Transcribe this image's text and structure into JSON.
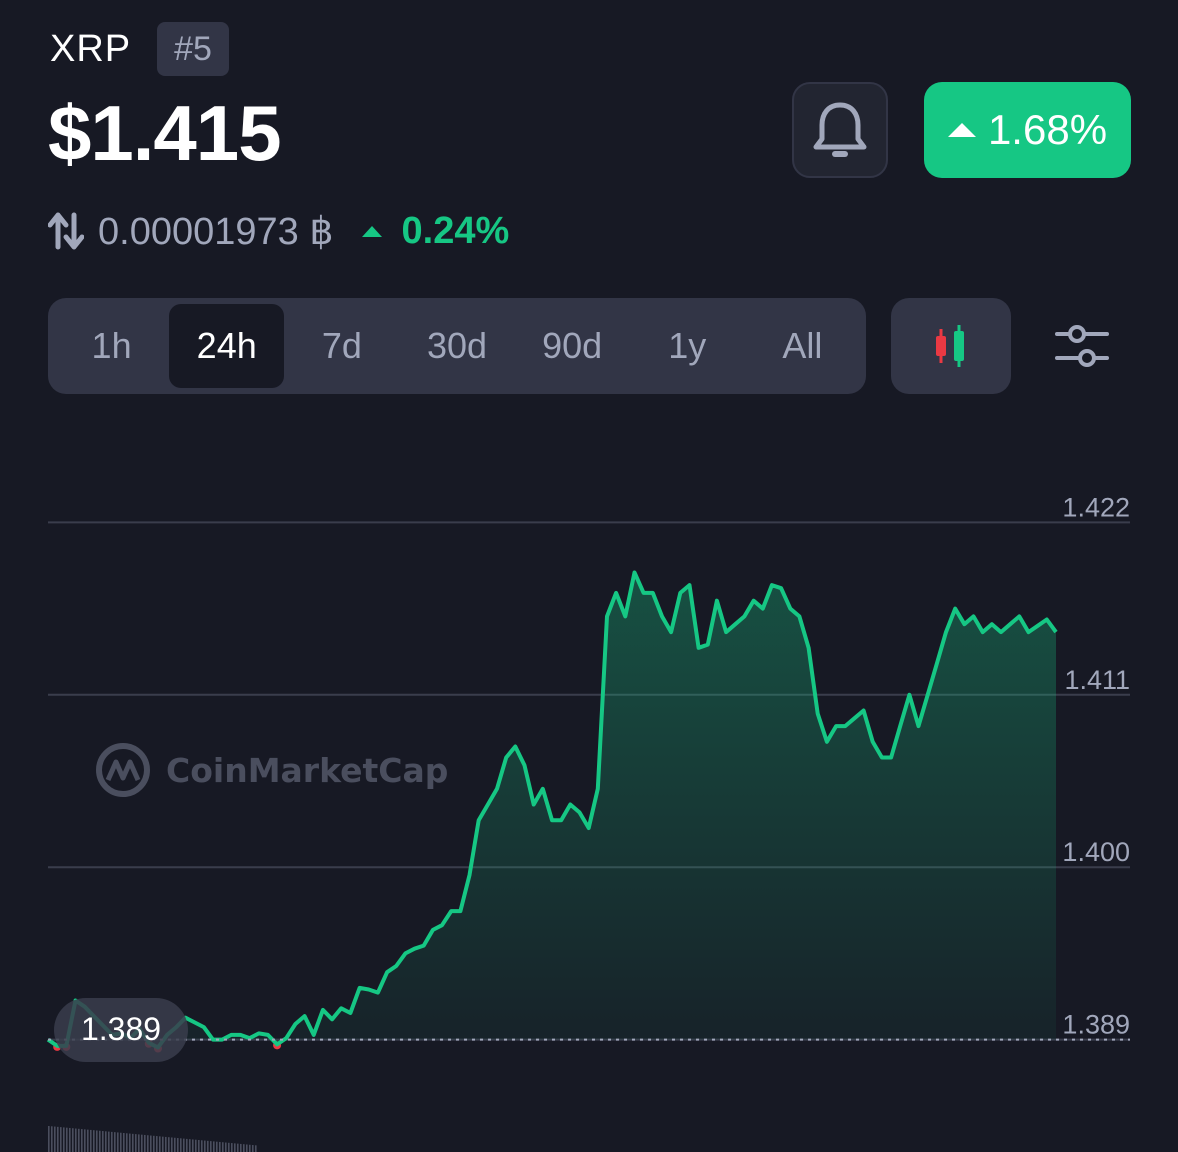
{
  "coin": {
    "symbol": "XRP",
    "rank": "#5",
    "price": "$1.415",
    "change_24h": "1.68%",
    "btc_price": "0.00001973 ฿",
    "btc_change": "0.24%"
  },
  "range_tabs": [
    "1h",
    "24h",
    "7d",
    "30d",
    "90d",
    "1y",
    "All"
  ],
  "active_range": "24h",
  "colors": {
    "background": "#171924",
    "up": "#16c784",
    "down": "#ea3943",
    "panel": "#323546"
  },
  "icons": [
    "bell-icon",
    "up-triangle-icon",
    "swap-icon",
    "candlestick-icon",
    "settings-sliders-icon",
    "coinmarketcap-logo"
  ],
  "watermark": "CoinMarketCap",
  "chart_data": {
    "type": "area",
    "y_ticks": [
      "1.422",
      "1.411",
      "1.400",
      "1.389"
    ],
    "ylim": [
      1.387,
      1.424
    ],
    "baseline": 1.389,
    "start_label": "1.389",
    "grid": true,
    "y": [
      1.389,
      1.3886,
      1.3886,
      1.3915,
      1.3911,
      1.3905,
      1.3899,
      1.3893,
      1.3894,
      1.3891,
      1.3897,
      1.3888,
      1.3885,
      1.3893,
      1.3898,
      1.3904,
      1.3901,
      1.3898,
      1.389,
      1.389,
      1.3893,
      1.3893,
      1.3891,
      1.3894,
      1.3893,
      1.3887,
      1.3891,
      1.39,
      1.3905,
      1.3893,
      1.3909,
      1.3903,
      1.391,
      1.3907,
      1.3923,
      1.3922,
      1.392,
      1.3933,
      1.3937,
      1.3945,
      1.3948,
      1.395,
      1.396,
      1.3963,
      1.3972,
      1.3972,
      1.3995,
      1.403,
      1.404,
      1.405,
      1.407,
      1.4077,
      1.4065,
      1.404,
      1.405,
      1.403,
      1.403,
      1.404,
      1.4035,
      1.4025,
      1.405,
      1.416,
      1.4175,
      1.416,
      1.4188,
      1.4175,
      1.4175,
      1.416,
      1.415,
      1.4175,
      1.418,
      1.414,
      1.4142,
      1.417,
      1.415,
      1.4155,
      1.416,
      1.417,
      1.4165,
      1.418,
      1.4178,
      1.4165,
      1.416,
      1.414,
      1.4098,
      1.408,
      1.409,
      1.409,
      1.4095,
      1.41,
      1.408,
      1.407,
      1.407,
      1.409,
      1.411,
      1.409,
      1.411,
      1.413,
      1.415,
      1.4165,
      1.4155,
      1.416,
      1.415,
      1.4155,
      1.415,
      1.4155,
      1.416,
      1.415,
      1.4154,
      1.4158,
      1.415
    ]
  }
}
